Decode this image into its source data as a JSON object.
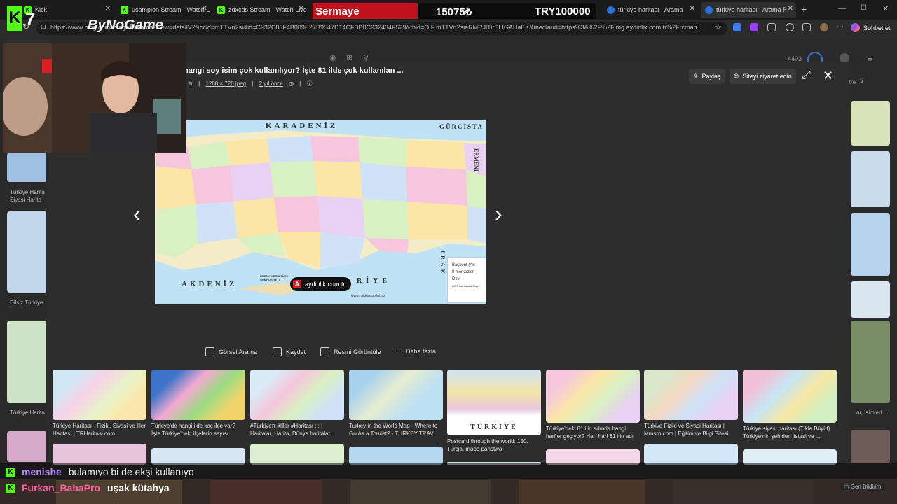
{
  "browser": {
    "tabs": [
      {
        "label": "Kick",
        "icon": "kick-icon"
      },
      {
        "label": "usampion Stream - Watch L",
        "icon": "kick-icon"
      },
      {
        "label": "zdxcds Stream - Watch Live",
        "icon": "kick-icon"
      },
      {
        "label": "türkiye haritası - Arama",
        "icon": "bing-icon"
      },
      {
        "label": "türkiye haritası - Arama Res",
        "icon": "bing-icon"
      }
    ],
    "url": "https://www.bing.com/images/search?view=detailV2&ccid=mTTVn2si&id=C932C83F4B089E27B9547D14CFBB0C932434F529&thid=OIP.mTTVn2sieRMRJlTirSLIGAHaEK&mediaurl=https%3A%2F%2Fimg.aydinlik.com.tr%2Frcman...",
    "chat_button": "Sohbet et"
  },
  "stream_overlay": {
    "label": "Sermaye",
    "balance": "15075₺",
    "target": "TRY100000",
    "logo_badge": "7",
    "logo_name": "ByNoGame"
  },
  "modal": {
    "title": "hangi soy isim çok kullanılıyor? İşte 81 ilde çok kullanılan ...",
    "meta_fragment": "tr",
    "meta_size": "1280 × 720 jpeg",
    "meta_age": "2 yıl önce",
    "share_label": "Paylaş",
    "visit_label": "Siteyi ziyaret edin",
    "source_label": "aydinlik.com.tr",
    "counter": "4403"
  },
  "map": {
    "top_label": "KARADENİZ",
    "left_label": "AKDENİZ",
    "corner_label": "GÜRCİSTA",
    "right_label": "ERMENİ",
    "bottom_label": "RİYE",
    "iraq_label": "IRAK",
    "cyprus_label": "KUZEY KIBRIS TÜRK CUMHURİYETİ",
    "website_label": "www.hakkindabilgi.biz",
    "legend": [
      "Başkent (An",
      "İl merkezleri",
      "Devl"
    ],
    "legend_note": "NOT: Haritadaki Ölçek"
  },
  "actions": [
    {
      "label": "Görsel Arama",
      "icon": "visual-search-icon"
    },
    {
      "label": "Kaydet",
      "icon": "save-icon"
    },
    {
      "label": "Resmi Görüntüle",
      "icon": "view-image-icon"
    },
    {
      "label": "Daha fazla",
      "icon": "more-icon"
    }
  ],
  "related": [
    {
      "caption": "Türkiye Haritası - Fiziki, Siyasi ve İller Haritası | TRHaritasi.com"
    },
    {
      "caption": "Türkiye'de hangi ilde kaç ilçe var? İşte Türkiye'deki ilçelerin sayısı"
    },
    {
      "caption": "#Türkiyeπ #İller #Haritası ::: | Haritalar, Harita, Dünya haritaları"
    },
    {
      "caption": "Turkey in the World Map - Where to Go As a Tourist? - TURKEY TRAV..."
    },
    {
      "caption": "Postcard through the world: 150. Turcja, mapa panstwa",
      "image_label": "TÜRKİYE"
    },
    {
      "caption": "Türkiye'deki 81 ilin adında hangi harfler geçiyor? Harf harf 81 ilin adı"
    },
    {
      "caption": "Türkiye Fiziki ve Siyasi Haritası | Mmsrn.com | Eğitim ve Bilgi Sitesi"
    },
    {
      "caption": "Türkiye siyasi haritası (Tıkla Büyüt) Türkiye'nin şehirleri listesi ve ..."
    }
  ],
  "left_captions": [
    "Türkiye Harita",
    "Siyasi Harita",
    "Dilsiz Türkiye",
    "Türkiye Harita"
  ],
  "right_captions": [
    "itre",
    "ar, İsimleri ..."
  ],
  "chat": [
    {
      "user": "menishe",
      "message": "bulamıyo bi de ekşi kullanıyo",
      "color": "#b388ff"
    },
    {
      "user": "Furkan_BabaPro",
      "message": "uşak kütahya",
      "color": "#ff5fa2"
    }
  ],
  "feedback_label": "Geri Bildirim",
  "colors": {
    "kick_green": "#53fc18",
    "bar_red": "#c0121b",
    "map_sea": "#bfe2f5"
  }
}
